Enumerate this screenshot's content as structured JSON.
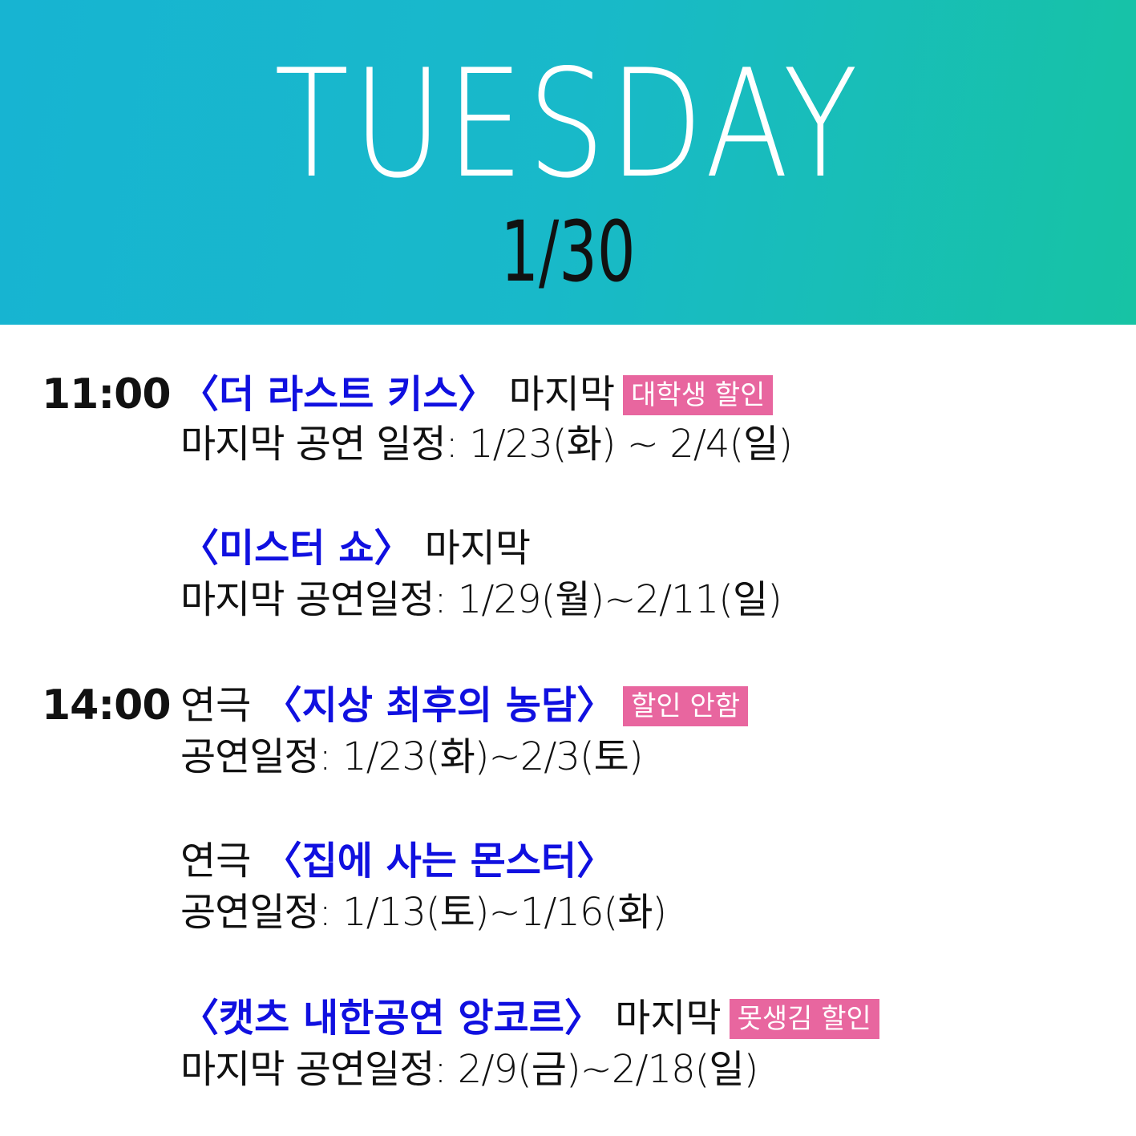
{
  "header": {
    "day": "TUESDAY",
    "date": "1/30"
  },
  "slots": [
    {
      "time": "11:00",
      "shows": [
        {
          "prefix": "",
          "title": "〈더 라스트 키스〉",
          "suffix": " 마지막",
          "badge": "대학생 할인",
          "schedule": "마지막 공연 일정: 1/23(화)  ~ 2/4(일)"
        },
        {
          "prefix": "",
          "title": "〈미스터 쇼〉",
          "suffix": " 마지막",
          "badge": "",
          "schedule": "마지막 공연일정: 1/29(월)~2/11(일)"
        }
      ]
    },
    {
      "time": "14:00",
      "shows": [
        {
          "prefix": "연극 ",
          "title": "〈지상 최후의 농담〉",
          "suffix": "",
          "badge": "할인 안함",
          "schedule": "공연일정: 1/23(화)~2/3(토)"
        },
        {
          "prefix": "연극 ",
          "title": "〈집에 사는 몬스터〉",
          "suffix": "",
          "badge": "",
          "schedule": "공연일정: 1/13(토)~1/16(화)"
        },
        {
          "prefix": "",
          "title": "〈캣츠 내한공연 앙코르〉",
          "suffix": " 마지막",
          "badge": "못생김 할인",
          "schedule": "마지막 공연일정: 2/9(금)~2/18(일)"
        }
      ]
    }
  ],
  "colors": {
    "header_start": "#17b4d2",
    "header_end": "#17c3a4",
    "title": "#1010e0",
    "badge": "#e8669f"
  }
}
